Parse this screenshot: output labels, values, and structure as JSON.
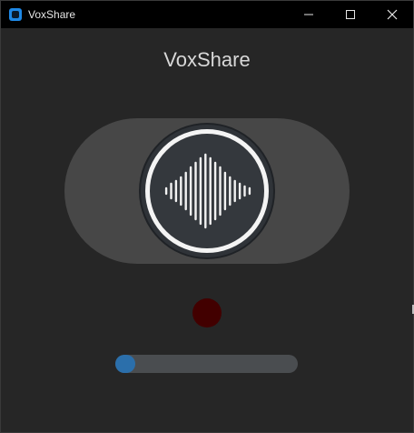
{
  "window": {
    "title": "VoxShare",
    "icon": "app-square-icon",
    "controls": {
      "minimize_icon": "minimize-icon",
      "maximize_icon": "maximize-icon",
      "close_icon": "close-icon"
    }
  },
  "app": {
    "title": "VoxShare"
  },
  "toggle": {
    "icon": "sound-wave-icon",
    "state": "off"
  },
  "record_indicator": {
    "state": "inactive",
    "color": "#420000"
  },
  "slider": {
    "value_fraction": 0.0
  },
  "colors": {
    "background": "#262626",
    "titlebar": "#000000",
    "accent": "#2b6fab",
    "track": "#474747"
  }
}
